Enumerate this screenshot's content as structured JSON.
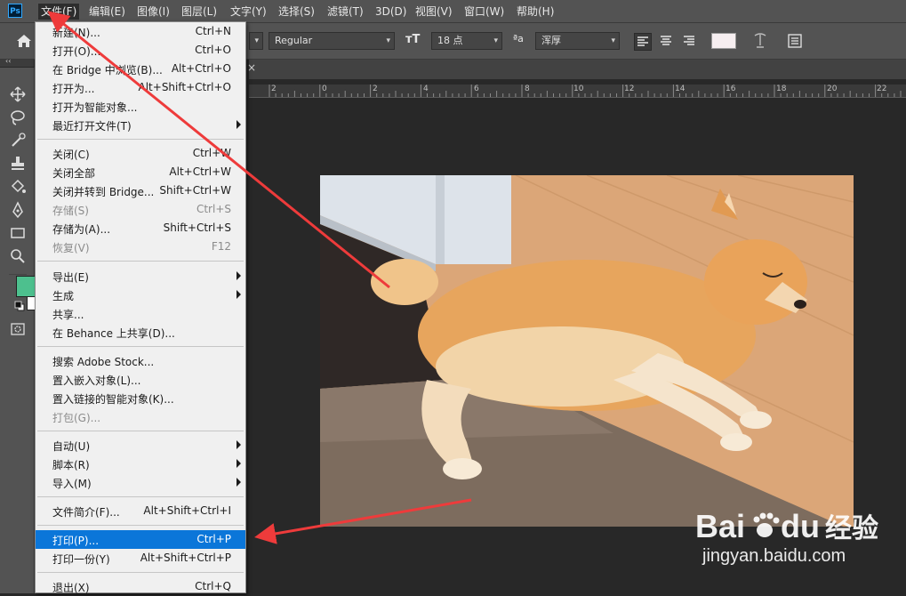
{
  "app": {
    "logo_text": "Ps"
  },
  "menubar": [
    {
      "label": "文件(F)",
      "active": true
    },
    {
      "label": "编辑(E)"
    },
    {
      "label": "图像(I)"
    },
    {
      "label": "图层(L)"
    },
    {
      "label": "文字(Y)"
    },
    {
      "label": "选择(S)"
    },
    {
      "label": "滤镜(T)"
    },
    {
      "label": "3D(D)"
    },
    {
      "label": "视图(V)"
    },
    {
      "label": "窗口(W)"
    },
    {
      "label": "帮助(H)"
    }
  ],
  "options": {
    "font_style": "Regular",
    "font_size": "18 点",
    "aa_label": "ªa",
    "antialias": "浑厚",
    "text_color": "#f6eef0"
  },
  "ruler_ticks": [
    "2",
    "0",
    "2",
    "4",
    "6",
    "8",
    "10",
    "12",
    "14",
    "16",
    "18",
    "20",
    "22"
  ],
  "file_menu": [
    {
      "label": "新建(N)...",
      "shortcut": "Ctrl+N"
    },
    {
      "label": "打开(O)...",
      "shortcut": "Ctrl+O"
    },
    {
      "label": "在 Bridge 中浏览(B)...",
      "shortcut": "Alt+Ctrl+O"
    },
    {
      "label": "打开为...",
      "shortcut": "Alt+Shift+Ctrl+O"
    },
    {
      "label": "打开为智能对象..."
    },
    {
      "label": "最近打开文件(T)",
      "submenu": true
    },
    {
      "separator": true
    },
    {
      "label": "关闭(C)",
      "shortcut": "Ctrl+W"
    },
    {
      "label": "关闭全部",
      "shortcut": "Alt+Ctrl+W"
    },
    {
      "label": "关闭并转到 Bridge...",
      "shortcut": "Shift+Ctrl+W"
    },
    {
      "label": "存储(S)",
      "shortcut": "Ctrl+S",
      "disabled": true
    },
    {
      "label": "存储为(A)...",
      "shortcut": "Shift+Ctrl+S"
    },
    {
      "label": "恢复(V)",
      "shortcut": "F12",
      "disabled": true
    },
    {
      "separator": true
    },
    {
      "label": "导出(E)",
      "submenu": true
    },
    {
      "label": "生成",
      "submenu": true
    },
    {
      "label": "共享..."
    },
    {
      "label": "在 Behance 上共享(D)..."
    },
    {
      "separator": true
    },
    {
      "label": "搜索 Adobe Stock..."
    },
    {
      "label": "置入嵌入对象(L)..."
    },
    {
      "label": "置入链接的智能对象(K)..."
    },
    {
      "label": "打包(G)...",
      "disabled": true
    },
    {
      "separator": true
    },
    {
      "label": "自动(U)",
      "submenu": true
    },
    {
      "label": "脚本(R)",
      "submenu": true
    },
    {
      "label": "导入(M)",
      "submenu": true
    },
    {
      "separator": true
    },
    {
      "label": "文件简介(F)...",
      "shortcut": "Alt+Shift+Ctrl+I"
    },
    {
      "separator": true
    },
    {
      "label": "打印(P)...",
      "shortcut": "Ctrl+P",
      "highlighted": true
    },
    {
      "label": "打印一份(Y)",
      "shortcut": "Alt+Shift+Ctrl+P"
    },
    {
      "separator": true
    },
    {
      "label": "退出(X)",
      "shortcut": "Ctrl+Q"
    }
  ],
  "colors": {
    "foreground": "#4dc08e",
    "background": "#ffffff",
    "menu_highlight": "#0b76d9",
    "annotation_arrow": "#ee3b3b"
  },
  "watermark": {
    "logo": "Bai du 经验",
    "url": "jingyan.baidu.com"
  }
}
